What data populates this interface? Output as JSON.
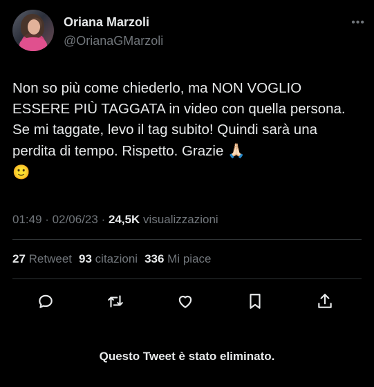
{
  "author": {
    "name": "Oriana Marzoli",
    "handle": "@OrianaGMarzoli"
  },
  "more_label": "•••",
  "tweet": {
    "text": "Non so più come chiederlo, ma NON VOGLIO ESSERE PIÙ TAGGATA in video con quella persona. Se mi taggate, levo il tag subito! Quindi sarà una perdita di tempo. Rispetto. Grazie ",
    "emoji_pray": "🙏🏻",
    "emoji_smile": "🙂"
  },
  "meta": {
    "time": "01:49",
    "separator": " · ",
    "date": "02/06/23",
    "separator2": " · ",
    "views_count": "24,5K",
    "views_label": " visualizzazioni"
  },
  "stats": {
    "retweets_count": "27",
    "retweets_label": " Retweet",
    "quotes_count": "93",
    "quotes_label": " citazioni",
    "likes_count": "336",
    "likes_label": " Mi piace"
  },
  "actions": {
    "icons": [
      "reply-icon",
      "retweet-icon",
      "like-icon",
      "bookmark-icon",
      "share-icon"
    ]
  },
  "notice": "Questo Tweet è stato eliminato.",
  "colors": {
    "background": "#000000",
    "text": "#e7e9ea",
    "secondary": "#71767b",
    "divider": "#2f3336"
  }
}
